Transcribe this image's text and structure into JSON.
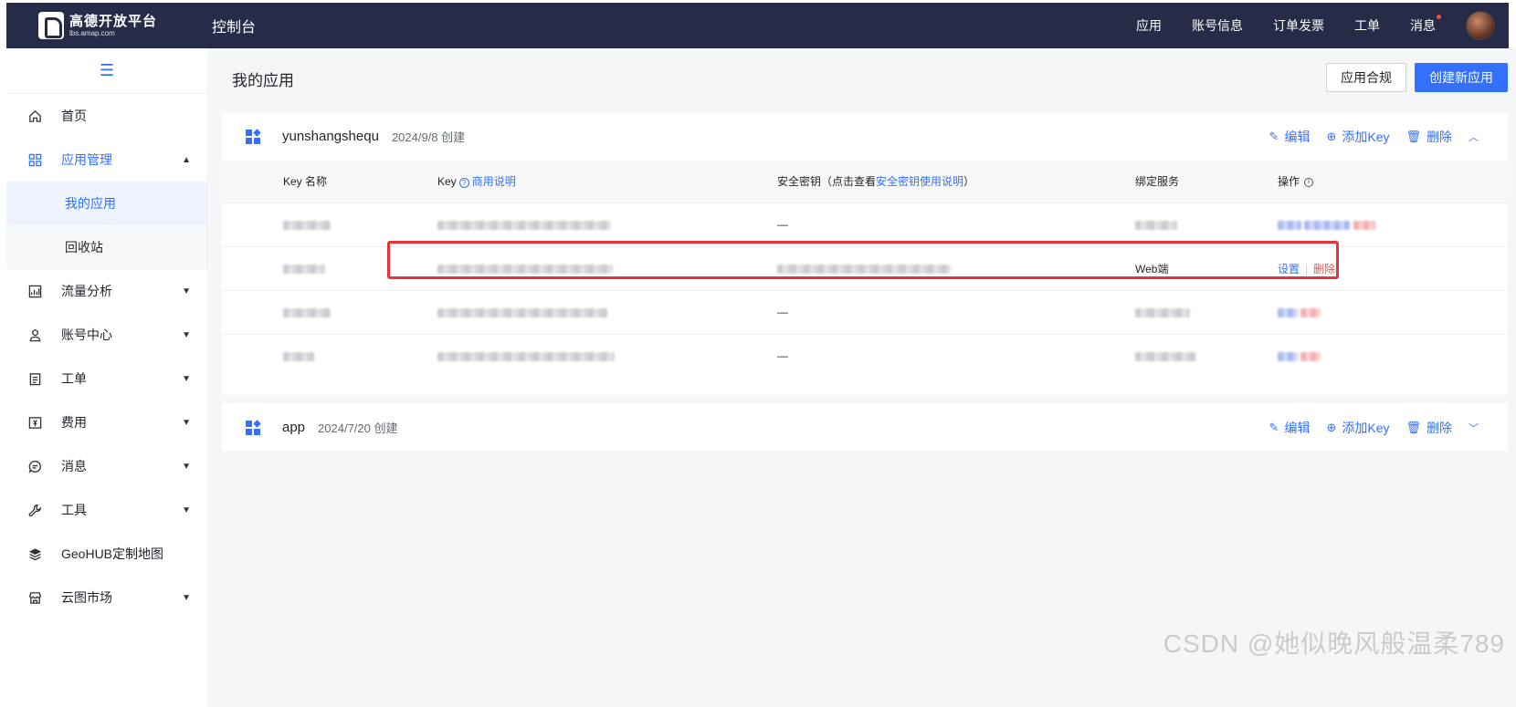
{
  "header": {
    "logo_name": "高德开放平台",
    "logo_domain": "lbs.amap.com",
    "console_title": "控制台",
    "nav": [
      "应用",
      "账号信息",
      "订单发票",
      "工单",
      "消息"
    ]
  },
  "sidebar": {
    "items": [
      {
        "label": "首页",
        "icon": "home-icon"
      },
      {
        "label": "应用管理",
        "icon": "grid-icon"
      },
      {
        "label": "我的应用"
      },
      {
        "label": "回收站"
      },
      {
        "label": "流量分析",
        "icon": "chart-icon"
      },
      {
        "label": "账号中心",
        "icon": "user-icon"
      },
      {
        "label": "工单",
        "icon": "ticket-icon"
      },
      {
        "label": "费用",
        "icon": "fee-icon"
      },
      {
        "label": "消息",
        "icon": "message-icon"
      },
      {
        "label": "工具",
        "icon": "wrench-icon"
      },
      {
        "label": "GeoHUB定制地图",
        "icon": "layers-icon"
      },
      {
        "label": "云图市场",
        "icon": "store-icon"
      }
    ]
  },
  "main": {
    "page_title": "我的应用",
    "compliance_button": "应用合规",
    "create_button": "创建新应用",
    "apps": [
      {
        "name": "yunshangshequ",
        "date": "2024/9/8 创建"
      },
      {
        "name": "app",
        "date": "2024/7/20 创建"
      }
    ],
    "actions": {
      "edit": "编辑",
      "add_key": "添加Key",
      "delete": "删除"
    },
    "table": {
      "col_keyname": "Key 名称",
      "col_key": "Key",
      "col_key_link": "商用说明",
      "col_secret_prefix": "安全密钥（点击查看",
      "col_secret_link": "安全密钥使用说明",
      "col_secret_suffix": "）",
      "col_service": "绑定服务",
      "col_ops": "操作",
      "row_dash": "—",
      "row2_service": "Web端",
      "op_settings": "设置",
      "op_delete": "删除"
    }
  },
  "watermark": "CSDN @她似晚风般温柔789",
  "colors": {
    "primary": "#3370ff",
    "danger": "#f54a45",
    "header_bg": "#262b47",
    "highlight": "#e8333a"
  }
}
